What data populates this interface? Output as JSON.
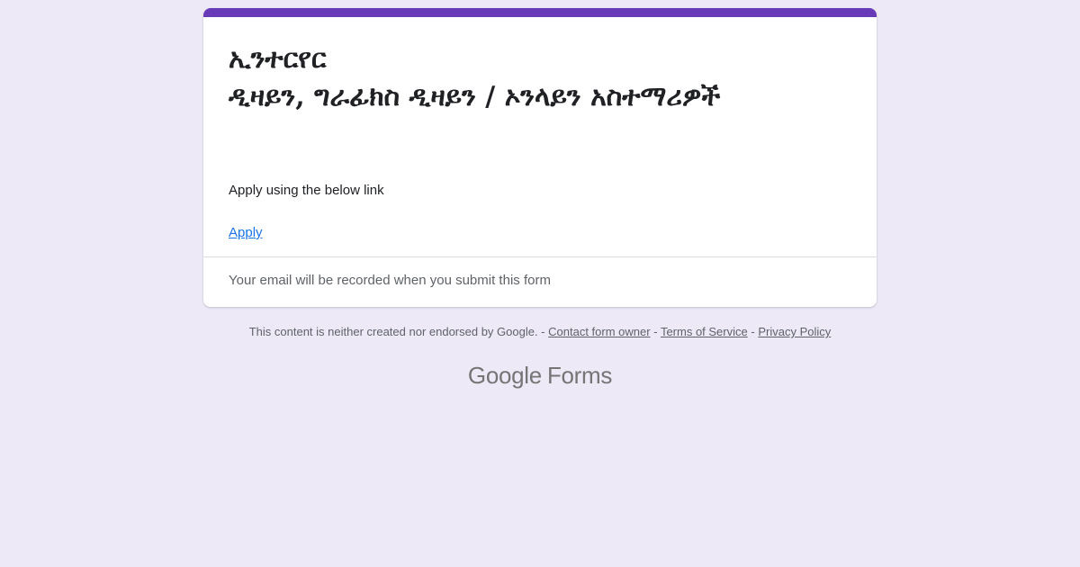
{
  "form": {
    "title": " ኢንተርየር\nዲዛይን, ግራፊክስ ዲዛይን / ኦንላይን አስተማሪዎች",
    "description": "Apply using the below link",
    "link_label": "Apply",
    "email_note": "Your email will be recorded when you submit this form"
  },
  "footer": {
    "disclaimer": "This content is neither created nor endorsed by Google. -",
    "sep": "-",
    "contact_label": "Contact form owner",
    "terms_label": "Terms of Service",
    "privacy_label": "Privacy Policy"
  },
  "brand": {
    "google": "Google",
    "forms": "Forms"
  },
  "colors": {
    "accent": "#673ab7",
    "background": "#ede9f7",
    "link": "#1a73e8"
  }
}
